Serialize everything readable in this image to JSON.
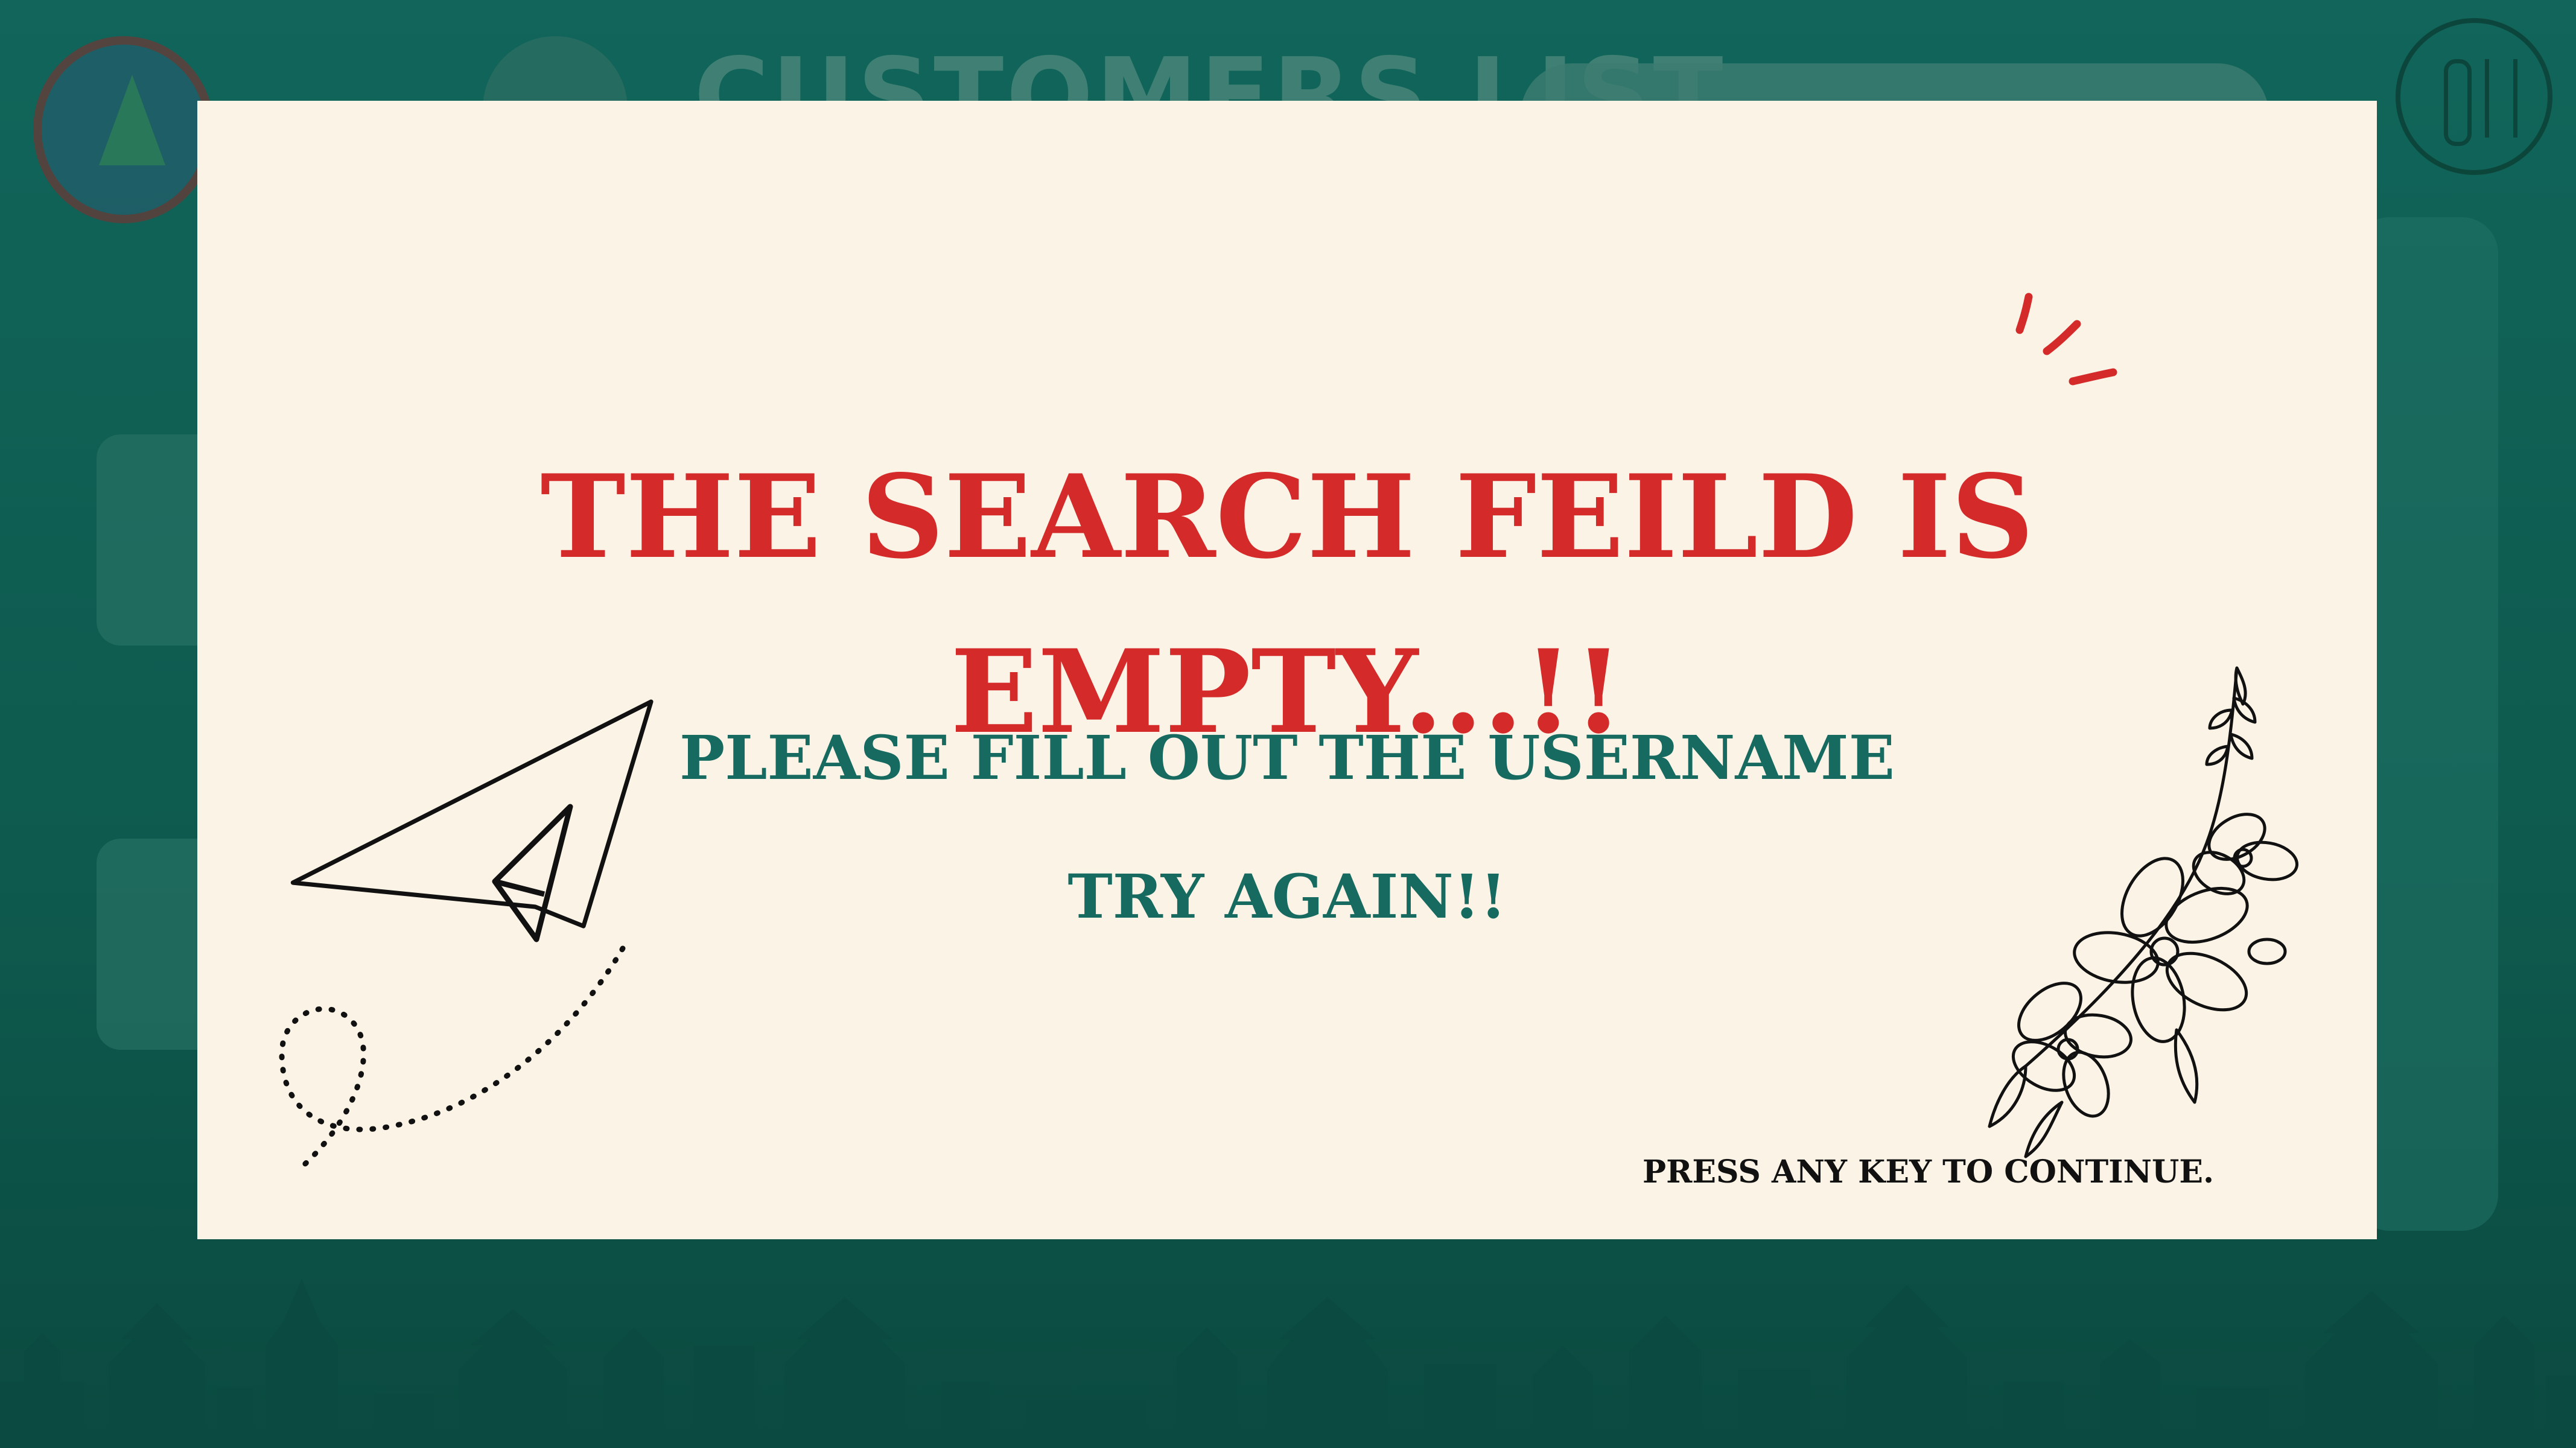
{
  "background": {
    "page_title": "CUSTOMERS LIST"
  },
  "dialog": {
    "headline_line1": "THE SEARCH FEILD IS",
    "headline_line2": "EMPTY...!!",
    "message": "PLEASE FILL OUT THE USERNAME",
    "retry": "TRY AGAIN!!",
    "continue_hint": "PRESS ANY KEY TO CONTINUE."
  },
  "colors": {
    "background": "#0f5c4f",
    "dialog_background": "#fbf3e6",
    "headline": "#d42a2a",
    "message": "#176a60",
    "hint": "#111111"
  },
  "icons": [
    "paper-plane-icon",
    "sparkle-lines-icon",
    "flower-illustration-icon",
    "back-arrow-icon",
    "search-icon",
    "restaurant-icon",
    "college-logo"
  ]
}
